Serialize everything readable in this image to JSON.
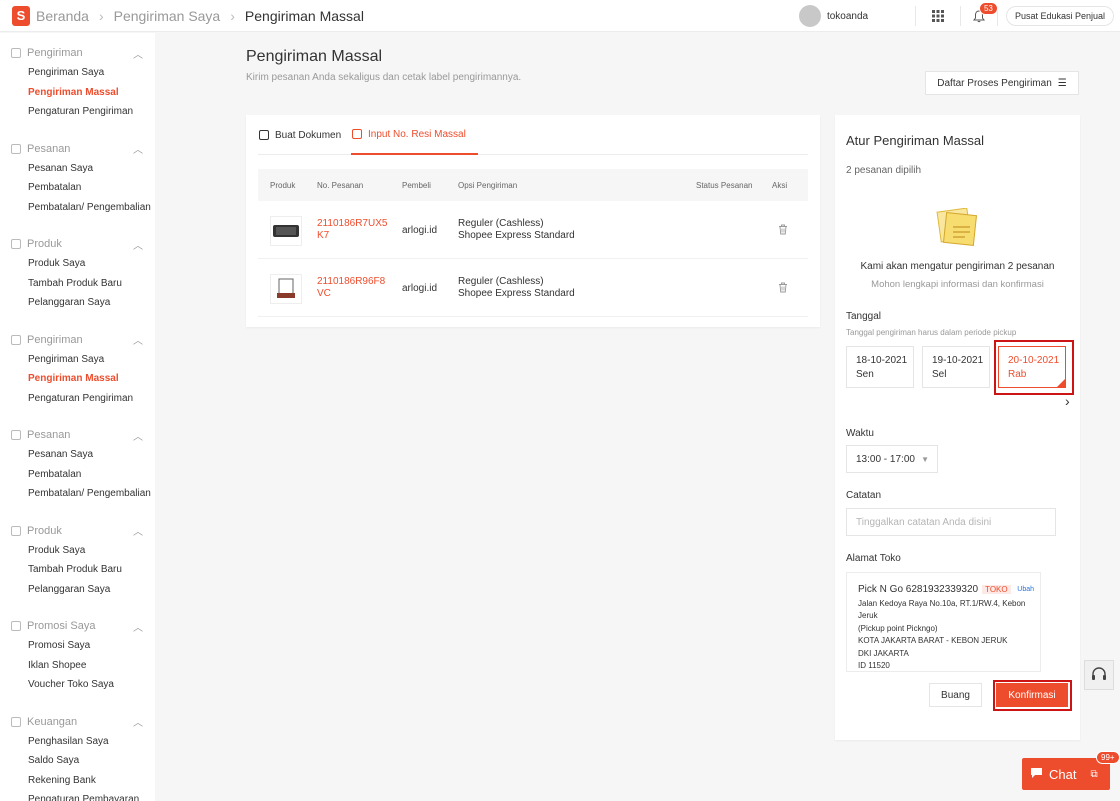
{
  "breadcrumb": {
    "home": "Beranda",
    "level2": "Pengiriman Saya",
    "current": "Pengiriman Massal"
  },
  "topbar": {
    "username": "tokoanda",
    "notif_count": "53",
    "edu_label": "Pusat Edukasi Penjual"
  },
  "sidebar": {
    "groups": [
      {
        "title": "Pengiriman",
        "items": [
          "Pengiriman Saya",
          "Pengiriman Massal",
          "Pengaturan Pengiriman"
        ]
      },
      {
        "title": "Pesanan",
        "items": [
          "Pesanan Saya",
          "Pembatalan",
          "Pembatalan/ Pengembalian"
        ]
      },
      {
        "title": "Produk",
        "items": [
          "Produk Saya",
          "Tambah Produk Baru",
          "Pelanggaran Saya"
        ]
      },
      {
        "title": "Pengiriman",
        "items": [
          "Pengiriman Saya",
          "Pengiriman Massal",
          "Pengaturan Pengiriman"
        ]
      },
      {
        "title": "Pesanan",
        "items": [
          "Pesanan Saya",
          "Pembatalan",
          "Pembatalan/ Pengembalian"
        ]
      },
      {
        "title": "Produk",
        "items": [
          "Produk Saya",
          "Tambah Produk Baru",
          "Pelanggaran Saya"
        ]
      },
      {
        "title": "Promosi Saya",
        "items": [
          "Promosi Saya",
          "Iklan Shopee",
          "Voucher Toko Saya"
        ]
      },
      {
        "title": "Keuangan",
        "items": [
          "Penghasilan Saya",
          "Saldo Saya",
          "Rekening Bank",
          "Pengaturan Pembayaran"
        ]
      }
    ]
  },
  "main": {
    "title": "Pengiriman Massal",
    "subtitle": "Kirim pesanan Anda sekaligus dan cetak label pengirimannya.",
    "daftar_button": "Daftar Proses Pengiriman"
  },
  "tabs": {
    "tab1": "Buat Dokumen",
    "tab2": "Input No. Resi Massal"
  },
  "table": {
    "headers": [
      "Produk",
      "No. Pesanan",
      "Pembeli",
      "Opsi Pengiriman",
      "Status Pesanan",
      "Aksi"
    ],
    "rows": [
      {
        "order_no": "2110186R7UX5K7",
        "buyer": "arlogi.id",
        "opsi1": "Reguler (Cashless)",
        "opsi2": "Shopee Express Standard"
      },
      {
        "order_no": "2110186R96F8VC",
        "buyer": "arlogi.id",
        "opsi1": "Reguler (Cashless)",
        "opsi2": "Shopee Express Standard"
      }
    ]
  },
  "panel": {
    "title": "Atur Pengiriman Massal",
    "selected": "2 pesanan dipilih",
    "message": "Kami akan mengatur pengiriman 2 pesanan",
    "hint": "Mohon lengkapi informasi dan konfirmasi",
    "tanggal_label": "Tanggal",
    "tanggal_hint": "Tanggal pengiriman harus dalam periode pickup",
    "dates": [
      {
        "date": "18-10-2021",
        "day": "Sen"
      },
      {
        "date": "19-10-2021",
        "day": "Sel"
      },
      {
        "date": "20-10-2021",
        "day": "Rab"
      }
    ],
    "waktu_label": "Waktu",
    "waktu_value": "13:00 - 17:00",
    "catatan_label": "Catatan",
    "catatan_placeholder": "Tinggalkan catatan Anda disini",
    "alamat_label": "Alamat Toko",
    "address": {
      "name": "Pick N Go 6281932339320",
      "tag": "TOKO",
      "edit": "Ubah",
      "line1": "Jalan Kedoya Raya No.10a, RT.1/RW.4, Kebon Jeruk",
      "line2": "(Pickup point Pickngo)",
      "line3": "KOTA JAKARTA BARAT - KEBON JERUK",
      "line4": "DKI JAKARTA",
      "line5": "ID 11520"
    },
    "buang": "Buang",
    "konfirmasi": "Konfirmasi"
  },
  "chat": {
    "label": "Chat",
    "badge": "99+"
  },
  "colors": {
    "accent": "#ee4d2d",
    "highlight_outline": "#cc1414",
    "link": "#2673dd"
  }
}
